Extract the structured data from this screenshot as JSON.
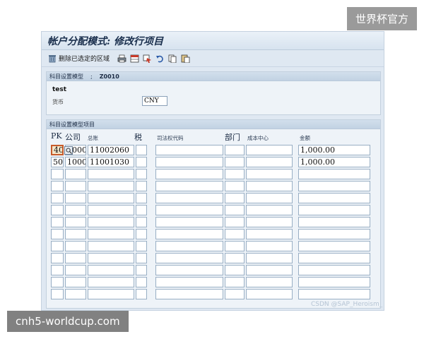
{
  "overlay": {
    "top_right": "世界杯官方",
    "bottom_left": "cnh5-worldcup.com",
    "bottom_right": "CSDN @SAP_Heroism_"
  },
  "window": {
    "title": "帐户分配模式: 修改行项目"
  },
  "toolbar": {
    "delete_label": "删除已选定的区域",
    "icons": [
      "trash-icon",
      "printer-icon",
      "local-layout-icon",
      "select-icon",
      "undo-icon",
      "copy-icon",
      "paste-icon"
    ]
  },
  "header": {
    "section_label": "科目设置模型",
    "separator": ";",
    "model_code": "Z0010",
    "description": "test",
    "currency_label": "货币",
    "currency_value": "CNY"
  },
  "items": {
    "section_label": "科目设置模型项目",
    "columns": {
      "pk": "PK",
      "company": "公司",
      "gl": "总账",
      "tax": "税",
      "jurisdiction": "司法权代码",
      "dept": "部门",
      "cost_center": "成本中心",
      "amount": "金额"
    },
    "rows": [
      {
        "pk": "40",
        "company": "1000",
        "gl": "11002060",
        "amount": "1,000.00"
      },
      {
        "pk": "50",
        "company": "1000",
        "gl": "11001030",
        "amount": "1,000.00"
      }
    ],
    "empty_rows": 11
  },
  "colors": {
    "panel_bg": "#eef3f8",
    "header_bar": "#c2d2e3",
    "focus_border": "#c75b2a"
  }
}
